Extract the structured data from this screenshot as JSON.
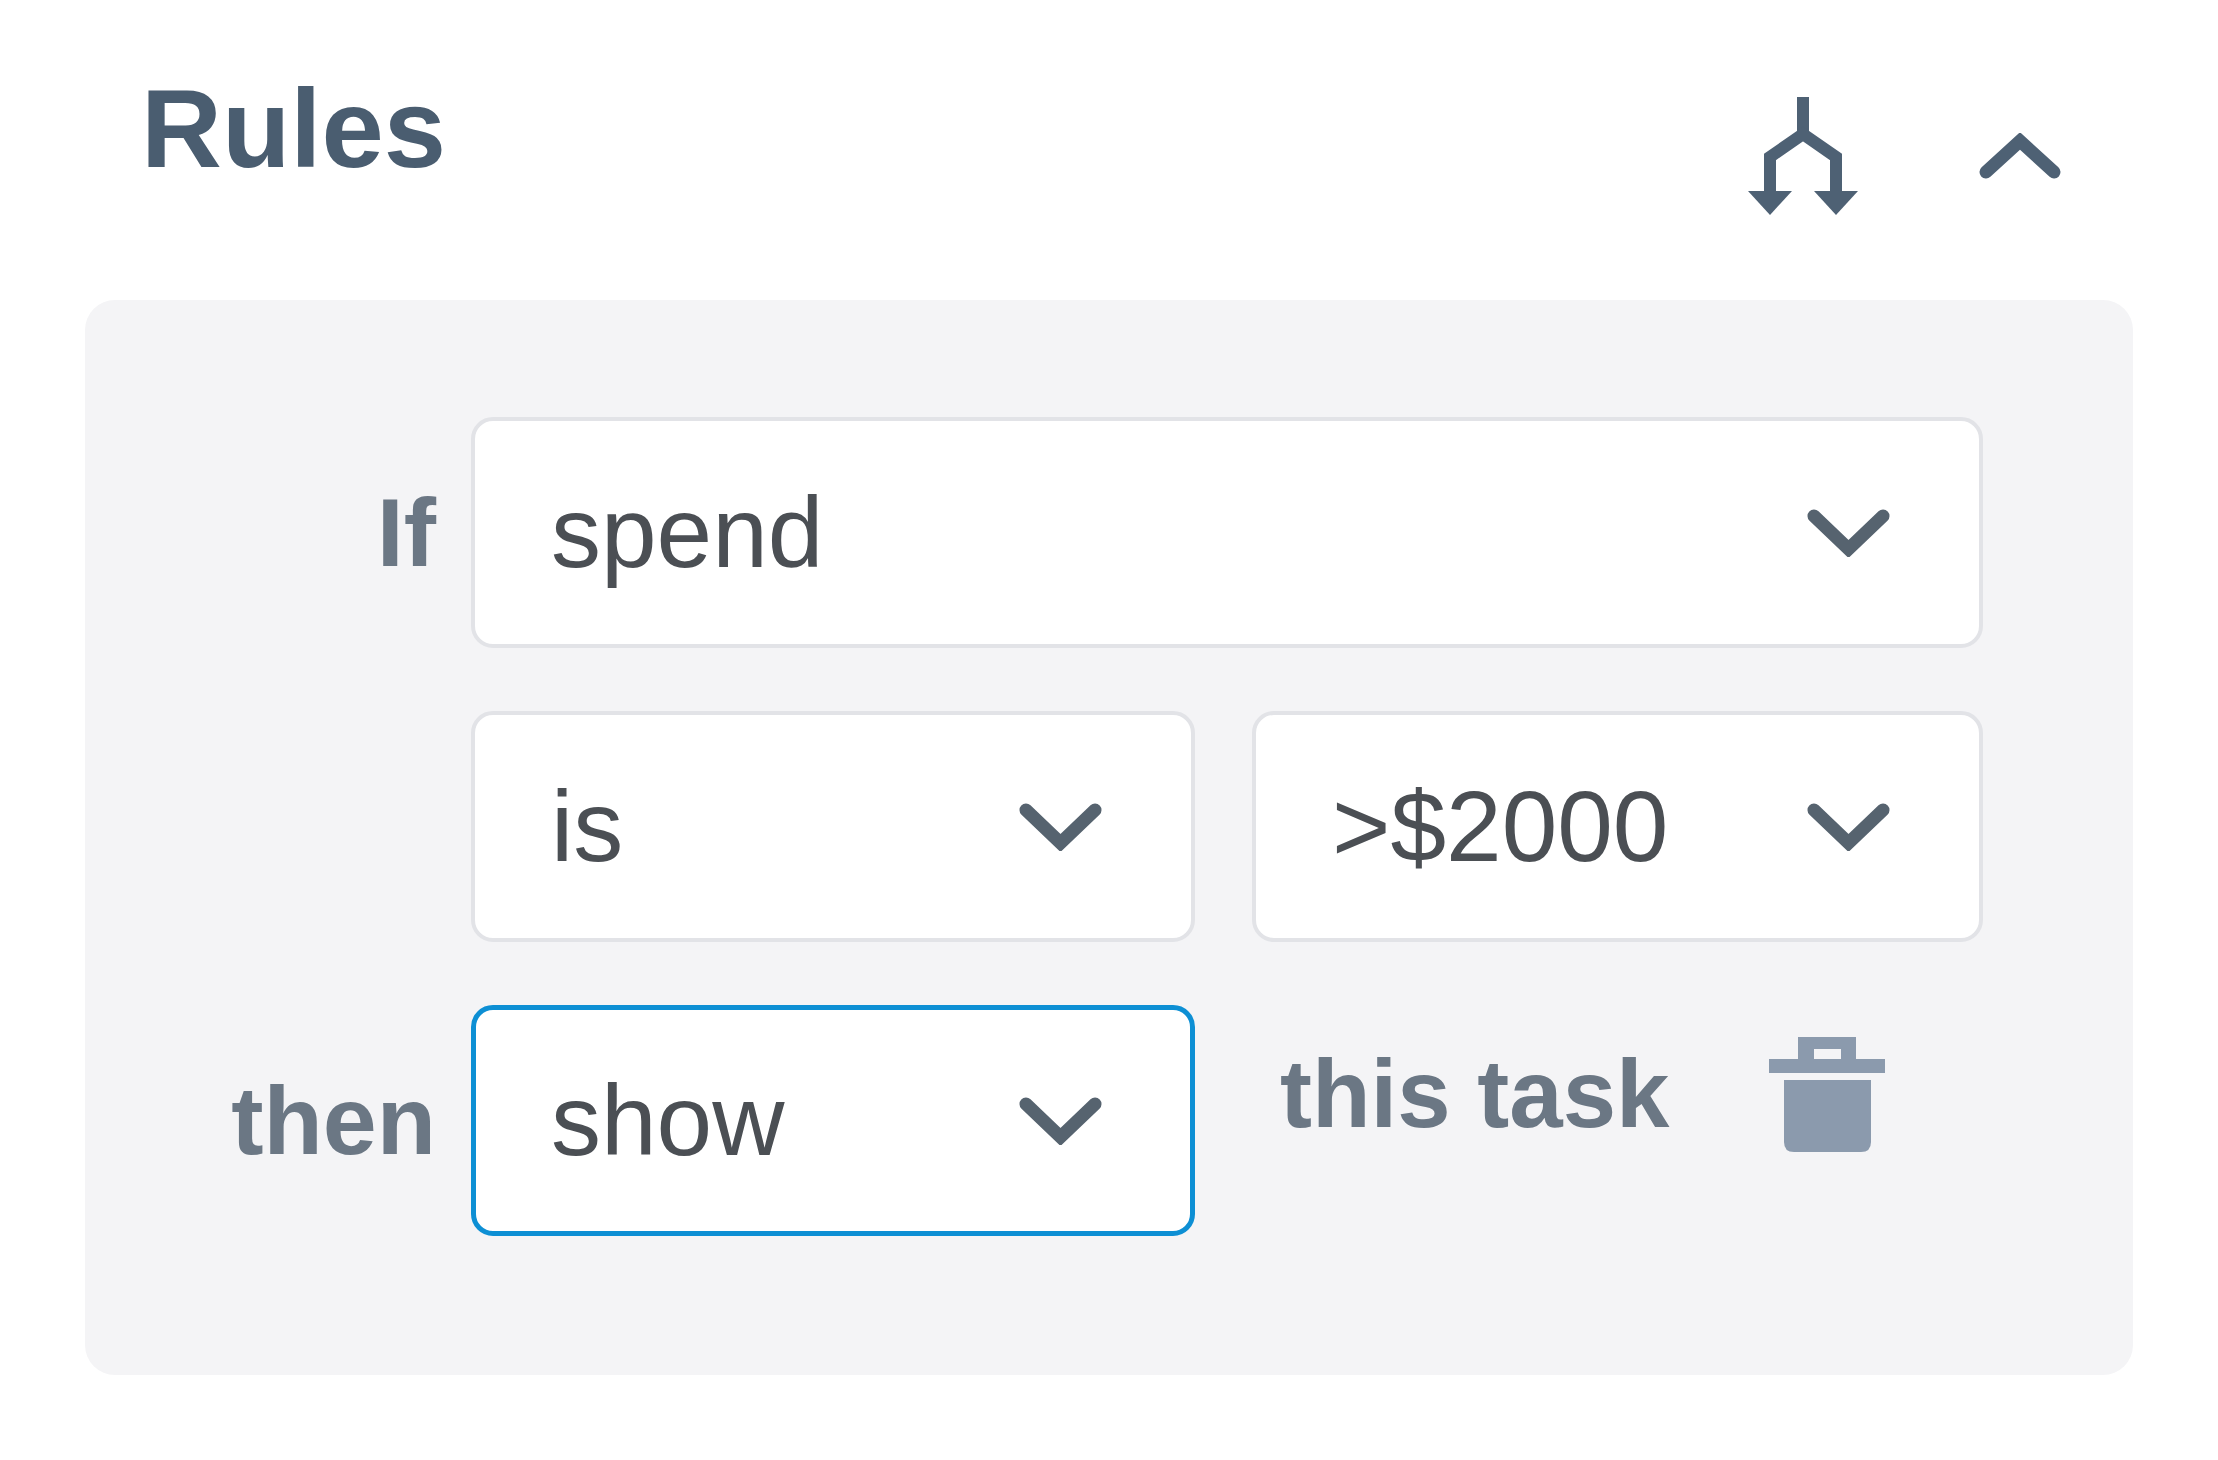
{
  "header": {
    "title": "Rules",
    "expanded": true
  },
  "rule": {
    "if_label": "If",
    "subject": {
      "value": "spend",
      "focused": false
    },
    "operator": {
      "value": "is",
      "focused": false
    },
    "threshold": {
      "value": ">$2000",
      "focused": false
    },
    "then_label": "then",
    "action": {
      "value": "show",
      "focused": true
    },
    "target": "this task"
  }
}
